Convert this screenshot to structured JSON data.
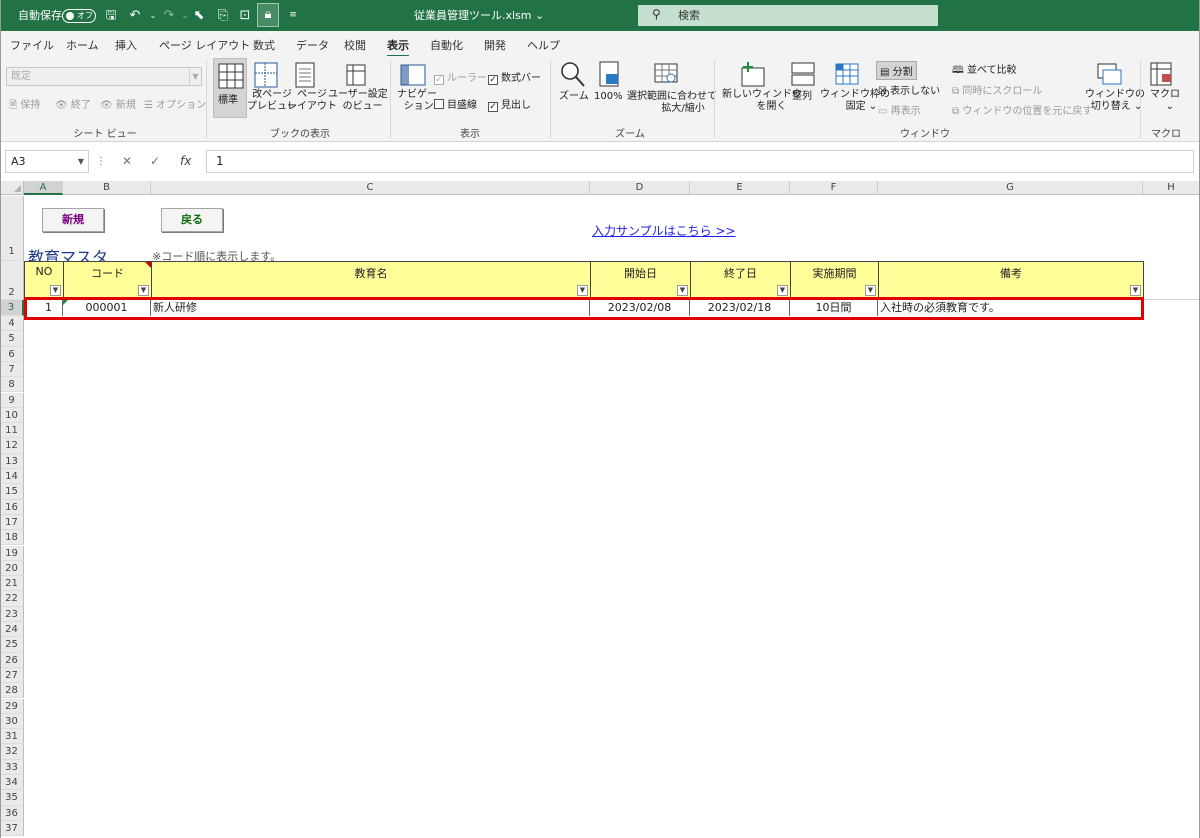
{
  "titlebar": {
    "autosave_label": "自動保存",
    "autosave_state": "オフ",
    "filename": "従業員管理ツール.xlsm ⌄",
    "search_placeholder": "検索"
  },
  "menu": [
    "ファイル",
    "ホーム",
    "挿入",
    "ページ レイアウト",
    "数式",
    "データ",
    "校閲",
    "表示",
    "自動化",
    "開発",
    "ヘルプ"
  ],
  "menu_active": "表示",
  "ribbon": {
    "sheet_view": {
      "combo": "既定",
      "keep": "保持",
      "exit": "終了",
      "new": "新規",
      "options": "オプション",
      "label": "シート ビュー"
    },
    "book_view": {
      "normal": "標準",
      "page_break_1": "改ページ",
      "page_break_2": "プレビュー",
      "page_layout_1": "ページ",
      "page_layout_2": "レイアウト",
      "custom_1": "ユーザー設定",
      "custom_2": "のビュー",
      "label": "ブックの表示"
    },
    "show": {
      "nav_1": "ナビゲー",
      "nav_2": "ション",
      "ruler": "ルーラー",
      "formula_bar": "数式バー",
      "gridlines": "目盛線",
      "headings": "見出し",
      "label": "表示"
    },
    "zoom": {
      "zoom": "ズーム",
      "pct": "100%",
      "fit_1": "選択範囲に合わせて",
      "fit_2": "拡大/縮小",
      "label": "ズーム"
    },
    "window": {
      "new_1": "新しいウィンドウ",
      "new_2": "を開く",
      "arrange": "整列",
      "freeze_1": "ウィンドウ枠の",
      "freeze_2": "固定 ⌄",
      "split": "分割",
      "hide": "表示しない",
      "unhide": "再表示",
      "side_by_side": "並べて比較",
      "sync_scroll": "同時にスクロール",
      "reset_pos": "ウィンドウの位置を元に戻す",
      "switch_1": "ウィンドウの",
      "switch_2": "切り替え ⌄",
      "label": "ウィンドウ"
    },
    "macro": {
      "macro": "マクロ",
      "caret": "⌄",
      "label": "マクロ"
    }
  },
  "formula_bar": {
    "name_box": "A3",
    "value": "1"
  },
  "columns": [
    "A",
    "B",
    "C",
    "D",
    "E",
    "F",
    "G",
    "H"
  ],
  "rows": [
    "1",
    "2",
    "3",
    "4",
    "5",
    "6",
    "7",
    "8",
    "9",
    "10",
    "11",
    "12",
    "13",
    "14",
    "15",
    "16",
    "17",
    "18",
    "19",
    "20",
    "21",
    "22",
    "23",
    "24",
    "25",
    "26",
    "27",
    "28",
    "29",
    "30",
    "31",
    "32",
    "33",
    "34",
    "35",
    "36",
    "37"
  ],
  "sheet": {
    "btn_new": "新規",
    "btn_back": "戻る",
    "link": "入力サンプルはこちら >>",
    "title": "教育マスタ",
    "note": "※コード順に表示します。",
    "headers": [
      "NO",
      "コード",
      "教育名",
      "開始日",
      "終了日",
      "実施期間",
      "備考"
    ],
    "row3": [
      "1",
      "000001",
      "新人研修",
      "2023/02/08",
      "2023/02/18",
      "10日間",
      "入社時の必須教育です。"
    ]
  }
}
